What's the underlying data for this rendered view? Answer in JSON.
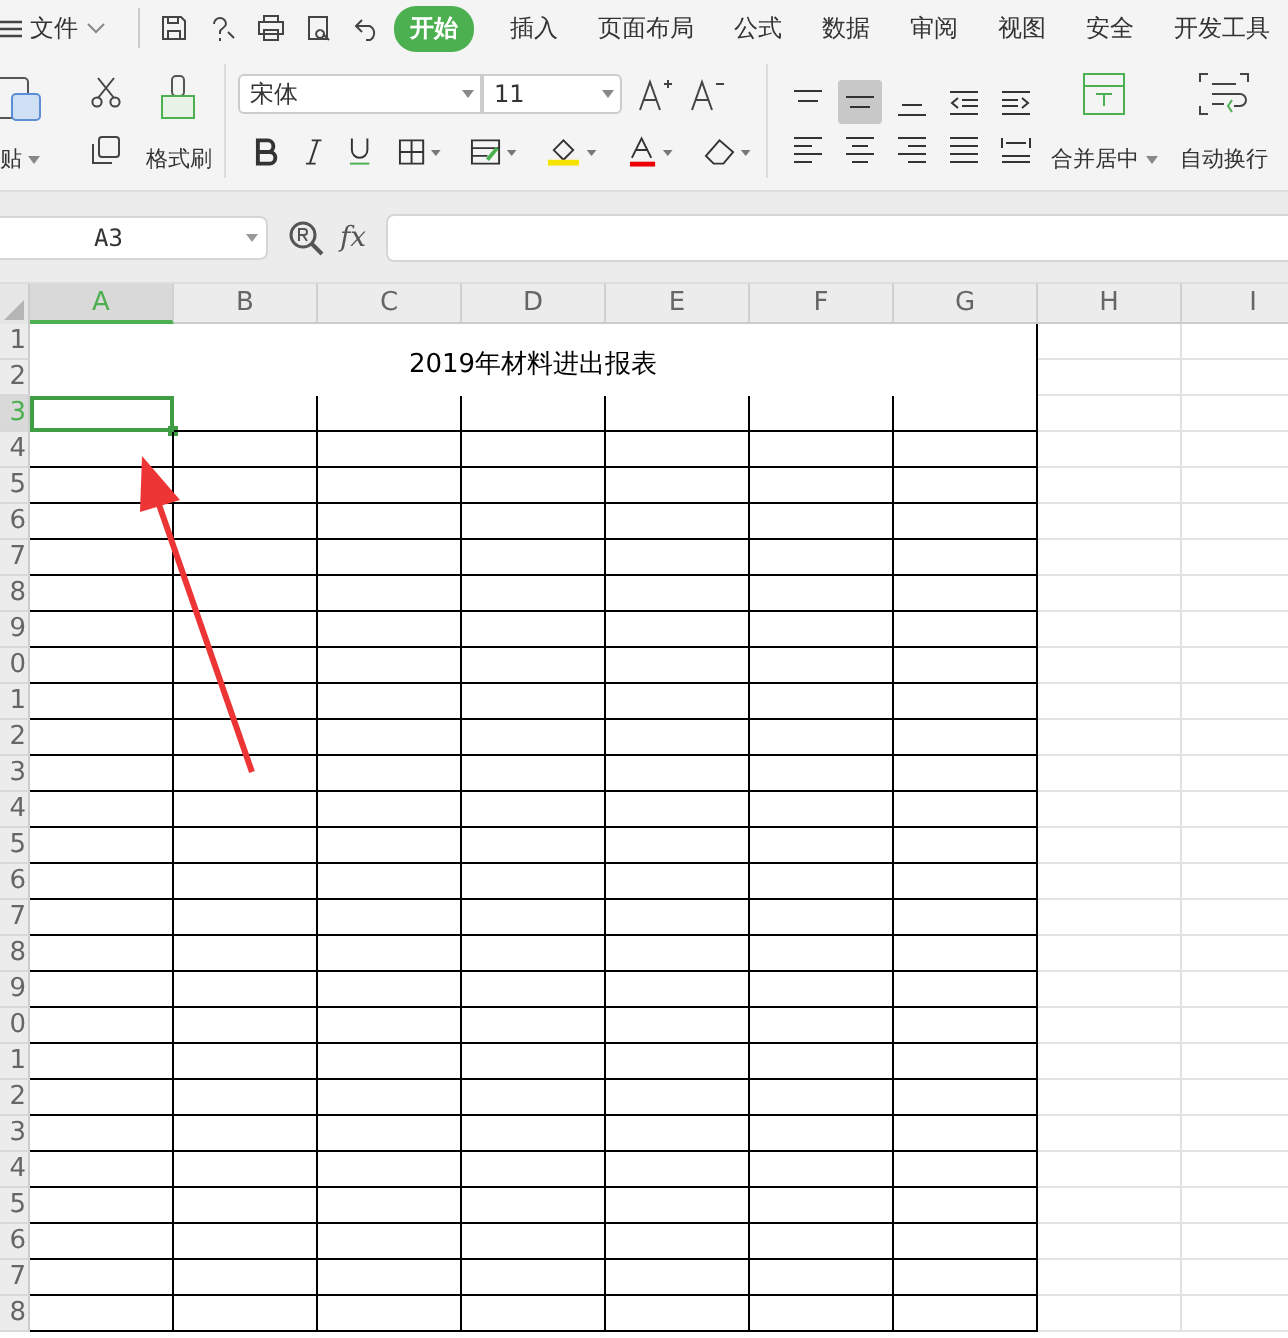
{
  "menu_bar": {
    "file_menu": "文件",
    "tabs": [
      {
        "label": "开始",
        "selected": true
      },
      {
        "label": "插入",
        "selected": false
      },
      {
        "label": "页面布局",
        "selected": false
      },
      {
        "label": "公式",
        "selected": false
      },
      {
        "label": "数据",
        "selected": false
      },
      {
        "label": "审阅",
        "selected": false
      },
      {
        "label": "视图",
        "selected": false
      },
      {
        "label": "安全",
        "selected": false
      },
      {
        "label": "开发工具",
        "selected": false
      }
    ]
  },
  "ribbon": {
    "paste_label": "贴",
    "format_painter_label": "格式刷",
    "font_name": "宋体",
    "font_size": "11",
    "merge_label": "合并居中",
    "wrap_label": "自动换行",
    "align_buttons": [
      {
        "selected": false
      },
      {
        "selected": true
      },
      {
        "selected": false
      },
      {
        "selected": false
      },
      {
        "selected": false
      }
    ]
  },
  "formula_bar": {
    "name_box": "A3",
    "fx_label": "fx"
  },
  "sheet": {
    "columns": [
      {
        "label": "A",
        "selected": true
      },
      {
        "label": "B",
        "selected": false
      },
      {
        "label": "C",
        "selected": false
      },
      {
        "label": "D",
        "selected": false
      },
      {
        "label": "E",
        "selected": false
      },
      {
        "label": "F",
        "selected": false
      },
      {
        "label": "G",
        "selected": false
      },
      {
        "label": "H",
        "selected": false
      },
      {
        "label": "I",
        "selected": false
      }
    ],
    "rows": [
      {
        "label": "1",
        "selected": false
      },
      {
        "label": "2",
        "selected": false
      },
      {
        "label": "3",
        "selected": true
      },
      {
        "label": "4",
        "selected": false
      },
      {
        "label": "5",
        "selected": false
      },
      {
        "label": "6",
        "selected": false
      },
      {
        "label": "7",
        "selected": false
      },
      {
        "label": "8",
        "selected": false
      },
      {
        "label": "9",
        "selected": false
      },
      {
        "label": "0",
        "selected": false
      },
      {
        "label": "1",
        "selected": false
      },
      {
        "label": "2",
        "selected": false
      },
      {
        "label": "3",
        "selected": false
      },
      {
        "label": "4",
        "selected": false
      },
      {
        "label": "5",
        "selected": false
      },
      {
        "label": "6",
        "selected": false
      },
      {
        "label": "7",
        "selected": false
      },
      {
        "label": "8",
        "selected": false
      },
      {
        "label": "9",
        "selected": false
      },
      {
        "label": "0",
        "selected": false
      },
      {
        "label": "1",
        "selected": false
      },
      {
        "label": "2",
        "selected": false
      },
      {
        "label": "3",
        "selected": false
      },
      {
        "label": "4",
        "selected": false
      },
      {
        "label": "5",
        "selected": false
      },
      {
        "label": "6",
        "selected": false
      },
      {
        "label": "7",
        "selected": false
      },
      {
        "label": "8",
        "selected": false
      }
    ],
    "title": "2019年材料进出报表"
  }
}
